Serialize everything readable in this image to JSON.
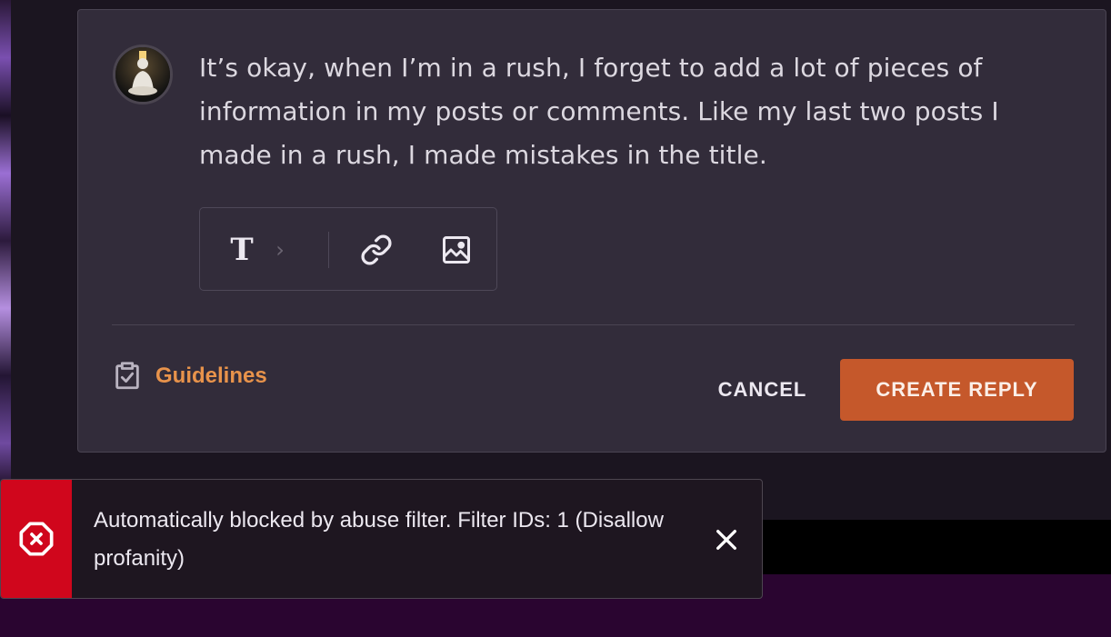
{
  "reply": {
    "comment_text": "It’s okay, when I’m in a rush, I forget to add a lot of pieces of information in my posts or comments. Like my last two posts I made in a rush, I made mistakes in the title.",
    "toolbar": {
      "text_tool": "T",
      "chevron": "›",
      "link_icon": "link-icon",
      "image_icon": "image-icon"
    },
    "guidelines_label": "Guidelines",
    "cancel_label": "CANCEL",
    "create_label": "CREATE REPLY"
  },
  "toast": {
    "message": "Automatically blocked by abuse filter. Filter IDs: 1 (Disallow profanity)",
    "error_icon": "error-octagon-icon",
    "close_icon": "close-icon"
  },
  "colors": {
    "accent_orange": "#c5582b",
    "guidelines_orange": "#e8934b",
    "error_red": "#d0061c",
    "card_bg": "#322c3a"
  }
}
